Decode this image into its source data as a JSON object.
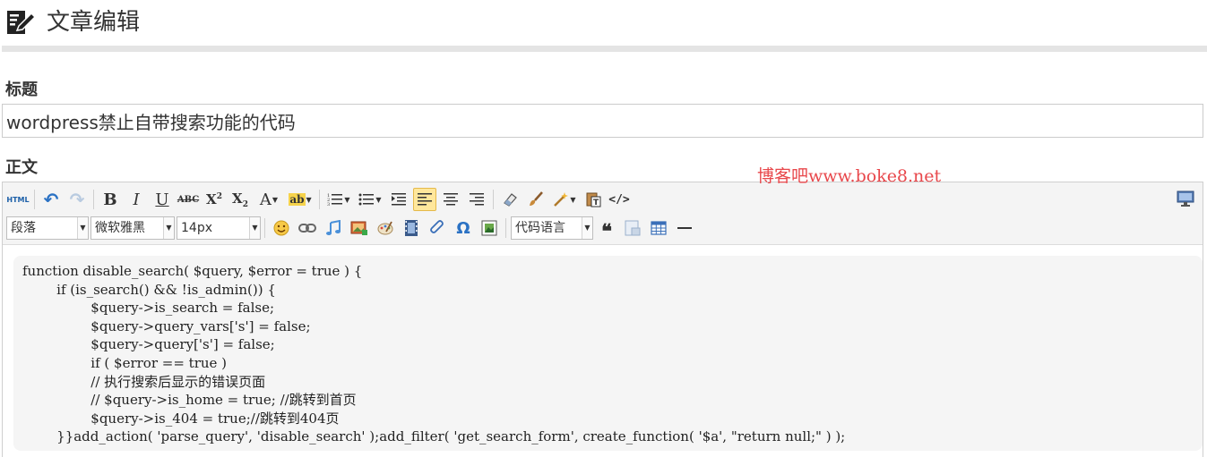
{
  "header": {
    "title": "文章编辑",
    "icon": "edit-document-icon"
  },
  "form": {
    "title_label": "标题",
    "title_value": "wordpress禁止自带搜索功能的代码",
    "body_label": "正文"
  },
  "watermark": "博客吧www.boke8.net",
  "toolbar": {
    "row1": [
      {
        "name": "html-source-button",
        "icon": "html-icon",
        "glyph": "HTML"
      },
      {
        "name": "undo-button",
        "icon": "undo-icon",
        "glyph": "↶"
      },
      {
        "name": "redo-button",
        "icon": "redo-icon",
        "glyph": "↷"
      },
      {
        "name": "bold-button",
        "icon": "bold-icon",
        "glyph": "B"
      },
      {
        "name": "italic-button",
        "icon": "italic-icon",
        "glyph": "I"
      },
      {
        "name": "underline-button",
        "icon": "underline-icon",
        "glyph": "U"
      },
      {
        "name": "strikethrough-button",
        "icon": "strikethrough-icon",
        "glyph": "ABC"
      },
      {
        "name": "superscript-button",
        "icon": "superscript-icon",
        "glyph": "X²"
      },
      {
        "name": "subscript-button",
        "icon": "subscript-icon",
        "glyph": "X₂"
      },
      {
        "name": "font-color-button",
        "icon": "font-color-icon",
        "glyph": "A"
      },
      {
        "name": "highlight-button",
        "icon": "highlight-icon",
        "glyph": "ab"
      },
      {
        "name": "ordered-list-button",
        "icon": "ordered-list-icon",
        "glyph": "≡"
      },
      {
        "name": "unordered-list-button",
        "icon": "unordered-list-icon",
        "glyph": "≡"
      },
      {
        "name": "indent-button",
        "icon": "indent-icon",
        "glyph": "≡"
      },
      {
        "name": "align-left-button",
        "icon": "align-left-icon",
        "glyph": "≡"
      },
      {
        "name": "align-center-button",
        "icon": "align-center-icon",
        "glyph": "≡"
      },
      {
        "name": "align-right-button",
        "icon": "align-right-icon",
        "glyph": "≡"
      },
      {
        "name": "eraser-button",
        "icon": "eraser-icon",
        "glyph": "⌫"
      },
      {
        "name": "format-painter-button",
        "icon": "brush-icon",
        "glyph": "🖌"
      },
      {
        "name": "magic-format-button",
        "icon": "magic-wand-icon",
        "glyph": "✦"
      },
      {
        "name": "paste-text-button",
        "icon": "paste-text-icon",
        "glyph": "T"
      },
      {
        "name": "code-view-button",
        "icon": "code-icon",
        "glyph": "</>"
      }
    ],
    "paragraph_select": "段落",
    "font_select": "微软雅黑",
    "size_select": "14px",
    "code_language_select": "代码语言",
    "row2": [
      {
        "name": "emoticon-button",
        "icon": "smiley-icon"
      },
      {
        "name": "link-button",
        "icon": "link-icon"
      },
      {
        "name": "music-button",
        "icon": "music-icon"
      },
      {
        "name": "image-button",
        "icon": "image-icon"
      },
      {
        "name": "paint-button",
        "icon": "palette-icon"
      },
      {
        "name": "video-button",
        "icon": "film-icon"
      },
      {
        "name": "attachment-button",
        "icon": "paperclip-icon"
      },
      {
        "name": "special-char-button",
        "icon": "omega-icon",
        "glyph": "Ω"
      },
      {
        "name": "insert-frame-button",
        "icon": "frame-icon"
      }
    ],
    "row2b": [
      {
        "name": "blockquote-button",
        "icon": "quote-icon",
        "glyph": "❝"
      },
      {
        "name": "word-image-button",
        "icon": "word-image-icon"
      },
      {
        "name": "table-button",
        "icon": "table-icon"
      },
      {
        "name": "horizontal-rule-button",
        "icon": "horizontal-rule-icon",
        "glyph": "—"
      }
    ],
    "fullscreen_icon": "monitor-icon"
  },
  "code_lines": [
    "function disable_search( $query, $error = true ) {",
    "        if (is_search() && !is_admin()) {",
    "                $query->is_search = false;",
    "                $query->query_vars['s'] = false;",
    "                $query->query['s'] = false;",
    "                if ( $error == true )",
    "                // 执行搜索后显示的错误页面",
    "                // $query->is_home = true; //跳转到首页",
    "                $query->is_404 = true;//跳转到404页",
    "        }}add_action( 'parse_query', 'disable_search' );add_filter( 'get_search_form', create_function( '$a', \"return null;\" ) );"
  ],
  "colors": {
    "watermark": "#e8474b",
    "active_button": "#ffe79c",
    "code_bg": "#f5f5f5",
    "toolbar_bg": "#f4f4f4"
  }
}
